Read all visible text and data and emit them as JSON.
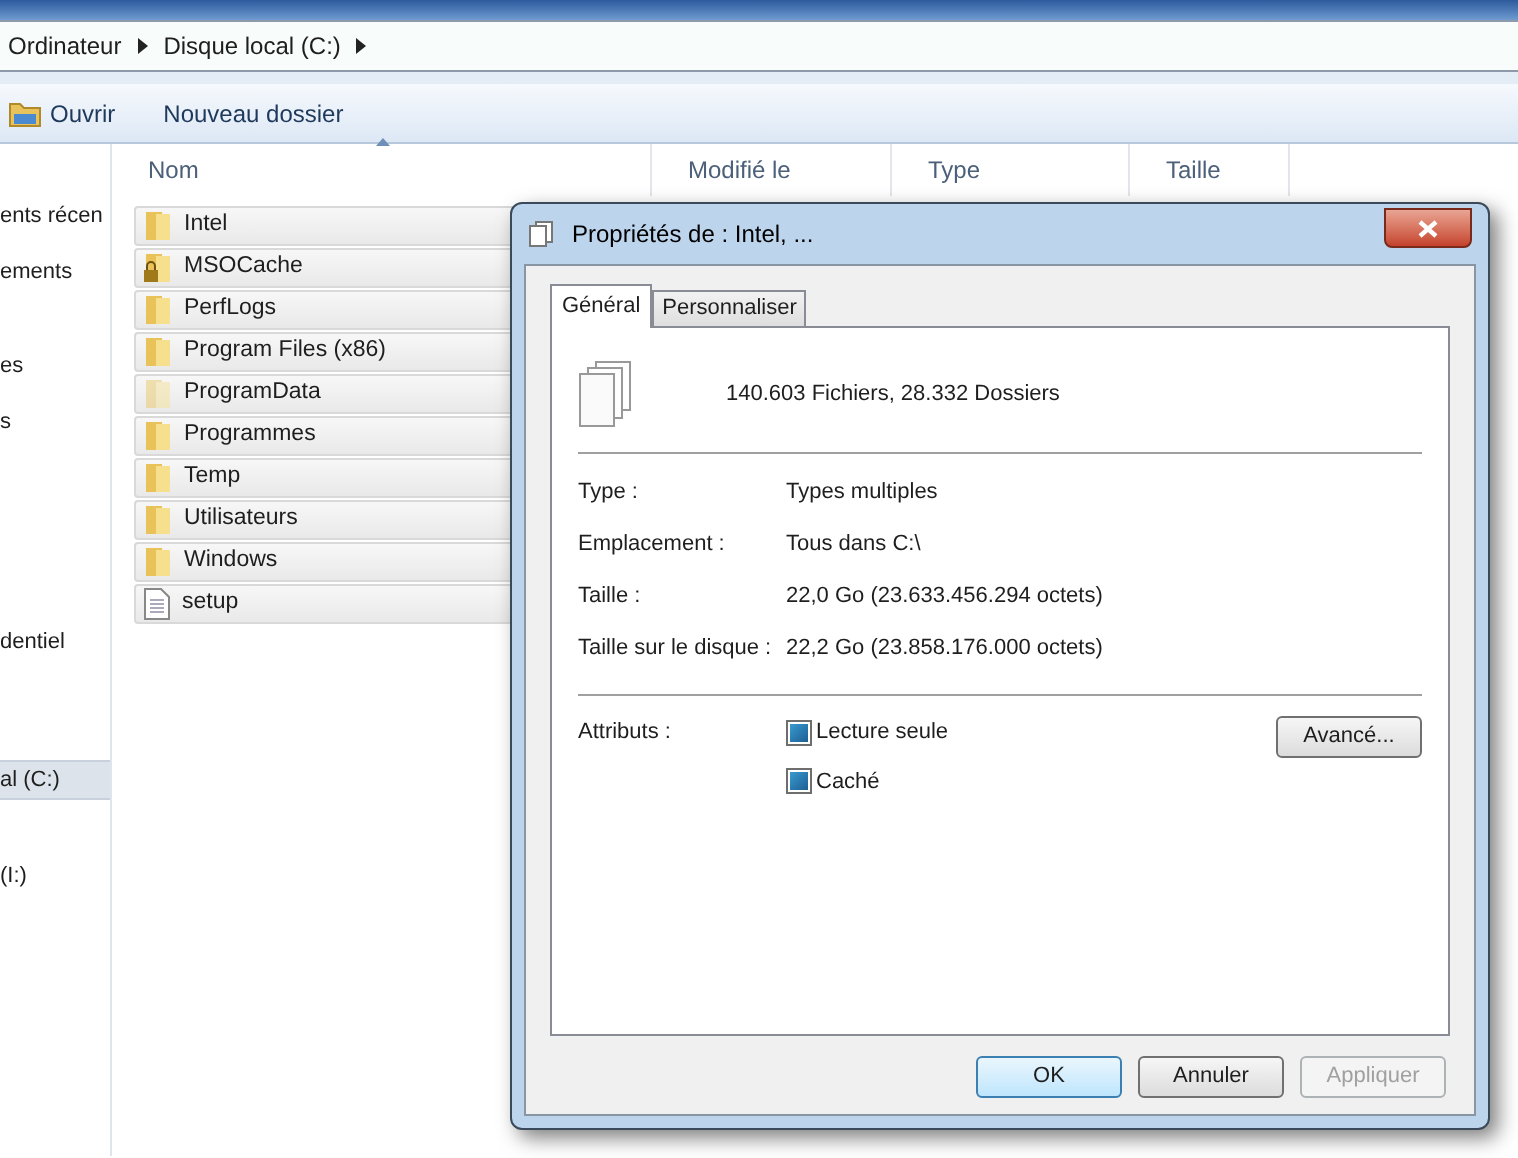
{
  "breadcrumb": [
    "Ordinateur",
    "Disque local (C:)"
  ],
  "toolbar": [
    "Ouvrir",
    "Nouveau dossier"
  ],
  "sidebar": {
    "items": [
      {
        "label": "ents récen",
        "selected": false
      },
      {
        "label": "ements",
        "selected": false
      },
      {
        "label": "es",
        "selected": false
      },
      {
        "label": "s",
        "selected": false
      },
      {
        "label": "dentiel",
        "selected": false
      },
      {
        "label": "al (C:)",
        "selected": true
      },
      {
        "label": "(I:)",
        "selected": false
      }
    ]
  },
  "columns": [
    "Nom",
    "Modifié le",
    "Type",
    "Taille"
  ],
  "files": [
    {
      "name": "Intel",
      "kind": "folder"
    },
    {
      "name": "MSOCache",
      "kind": "locked-folder"
    },
    {
      "name": "PerfLogs",
      "kind": "folder"
    },
    {
      "name": "Program Files (x86)",
      "kind": "folder"
    },
    {
      "name": "ProgramData",
      "kind": "hidden-folder"
    },
    {
      "name": "Programmes",
      "kind": "folder"
    },
    {
      "name": "Temp",
      "kind": "folder"
    },
    {
      "name": "Utilisateurs",
      "kind": "folder"
    },
    {
      "name": "Windows",
      "kind": "folder"
    },
    {
      "name": "setup",
      "kind": "file"
    }
  ],
  "dialog": {
    "title": "Propriétés de : Intel, ...",
    "tabs": [
      {
        "label": "Général",
        "selected": true
      },
      {
        "label": "Personnaliser",
        "selected": false
      }
    ],
    "summary": "140.603 Fichiers, 28.332 Dossiers",
    "properties": [
      {
        "label": "Type :",
        "value": "Types multiples"
      },
      {
        "label": "Emplacement :",
        "value": "Tous dans C:\\"
      },
      {
        "label": "Taille :",
        "value": "22,0 Go (23.633.456.294 octets)"
      },
      {
        "label": "Taille sur le disque :",
        "value": "22,2 Go (23.858.176.000 octets)"
      }
    ],
    "attributes_label": "Attributs :",
    "attributes": [
      {
        "label": "Lecture seule",
        "indeterminate": true
      },
      {
        "label": "Caché",
        "indeterminate": true
      }
    ],
    "advanced_button": "Avancé...",
    "buttons": [
      {
        "label": "OK",
        "default": true,
        "disabled": false
      },
      {
        "label": "Annuler",
        "default": false,
        "disabled": false
      },
      {
        "label": "Appliquer",
        "default": false,
        "disabled": true
      }
    ]
  }
}
